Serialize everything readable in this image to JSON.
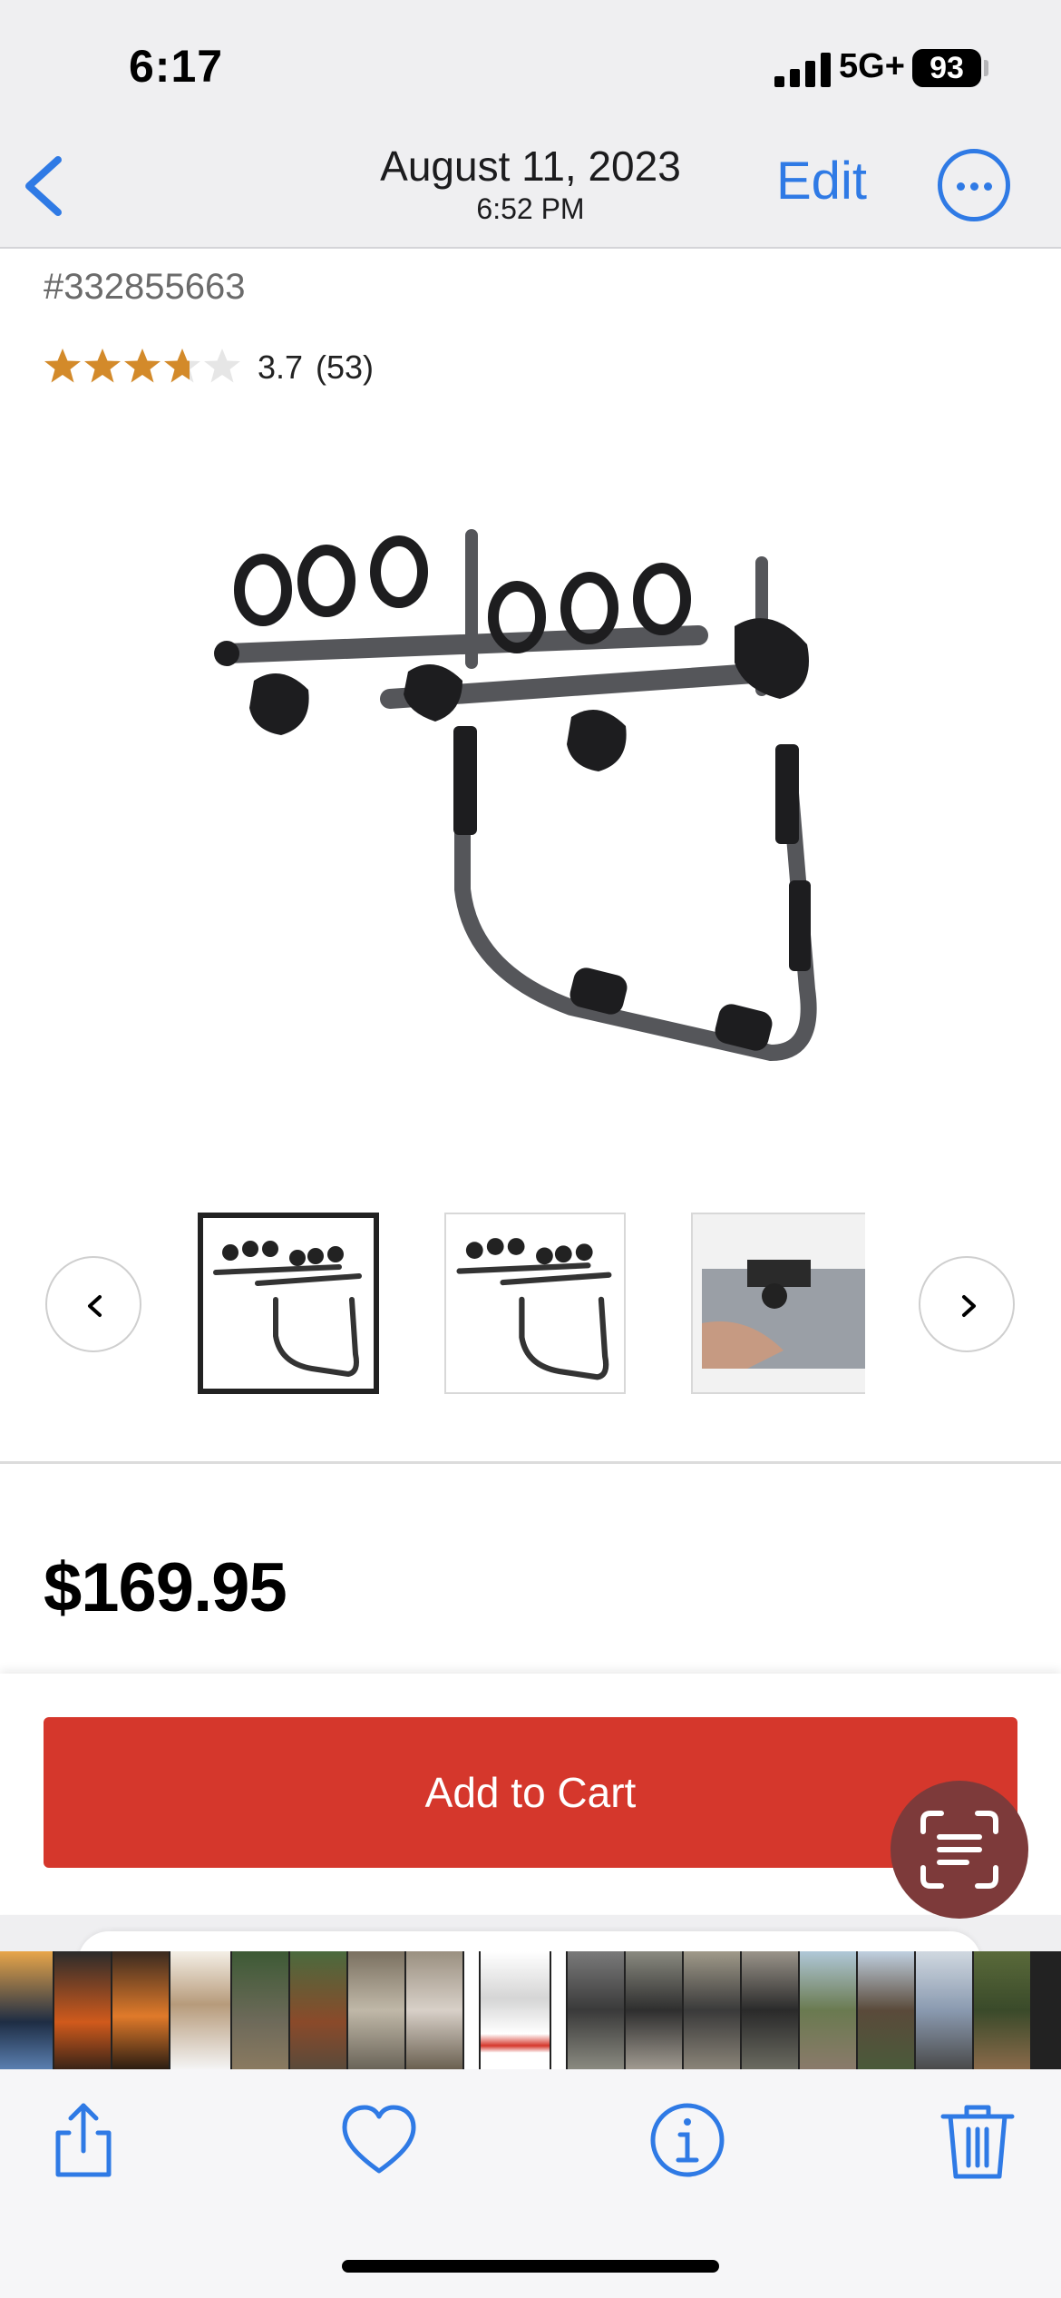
{
  "status_bar": {
    "time": "6:17",
    "network": "5G+",
    "battery": "93"
  },
  "nav": {
    "date": "August 11, 2023",
    "time": "6:52 PM",
    "edit_label": "Edit"
  },
  "product": {
    "sku": "#332855663",
    "rating": "3.7",
    "review_count": "(53)",
    "rating_value": 3.7,
    "price": "$169.95",
    "add_to_cart_label": "Add to Cart"
  },
  "colors": {
    "accent": "#2f7ae5",
    "cart_button": "#d5372c",
    "star": "#d38a2a"
  },
  "icons": [
    "back-chevron-icon",
    "more-icon",
    "prev-chevron-icon",
    "next-chevron-icon",
    "live-text-icon",
    "share-icon",
    "heart-icon",
    "info-icon",
    "trash-icon"
  ]
}
